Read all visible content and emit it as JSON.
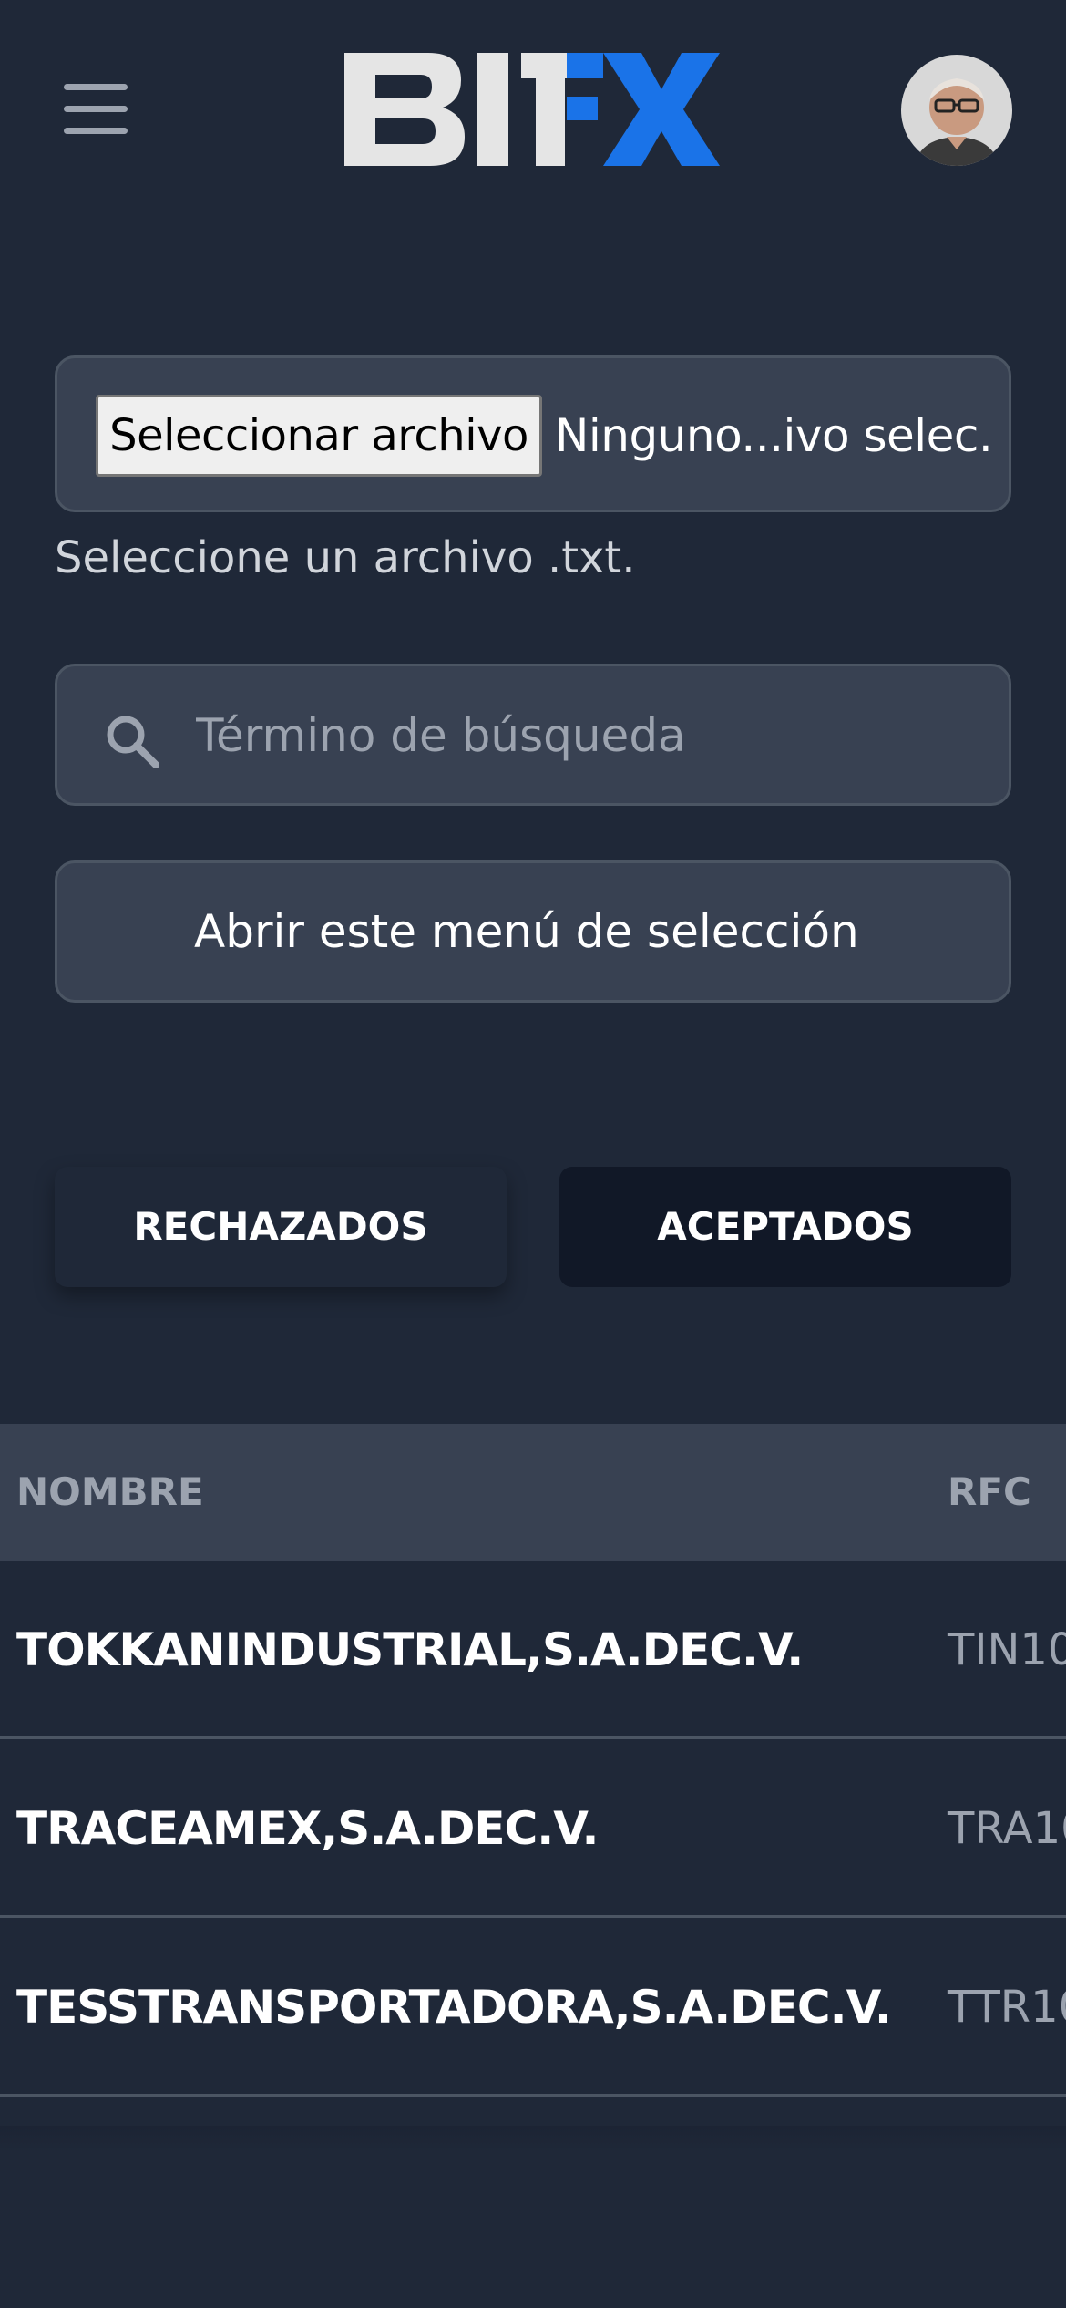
{
  "header": {
    "menu_icon": "hamburger-menu-icon",
    "logo_text": "BITFX",
    "avatar_icon": "user-avatar",
    "colors": {
      "logo_light": "#e5e5e5",
      "logo_accent": "#1a73e8"
    }
  },
  "file_upload": {
    "button_label": "Seleccionar archivo",
    "status_text": "Ninguno...ivo selec.",
    "help_text": "Seleccione un archivo .txt."
  },
  "search": {
    "icon": "search-icon",
    "placeholder": "Término de búsqueda"
  },
  "select_menu": {
    "label": "Abrir este menú de selección"
  },
  "tabs": [
    {
      "label": "RECHAZADOS",
      "active": false
    },
    {
      "label": "ACEPTADOS",
      "active": true
    }
  ],
  "table": {
    "columns": [
      "NOMBRE",
      "RFC"
    ],
    "rows": [
      {
        "nombre": "TOKKANINDUSTRIAL,S.A.DEC.V.",
        "rfc": "TIN10"
      },
      {
        "nombre": "TRACEAMEX,S.A.DEC.V.",
        "rfc": "TRA10"
      },
      {
        "nombre": "TESSTRANSPORTADORA,S.A.DEC.V.",
        "rfc": "TTR10"
      }
    ]
  },
  "colors": {
    "background": "#1f2838",
    "field_background": "#384152",
    "field_border": "#4b5563",
    "active_tab": "#111827"
  }
}
